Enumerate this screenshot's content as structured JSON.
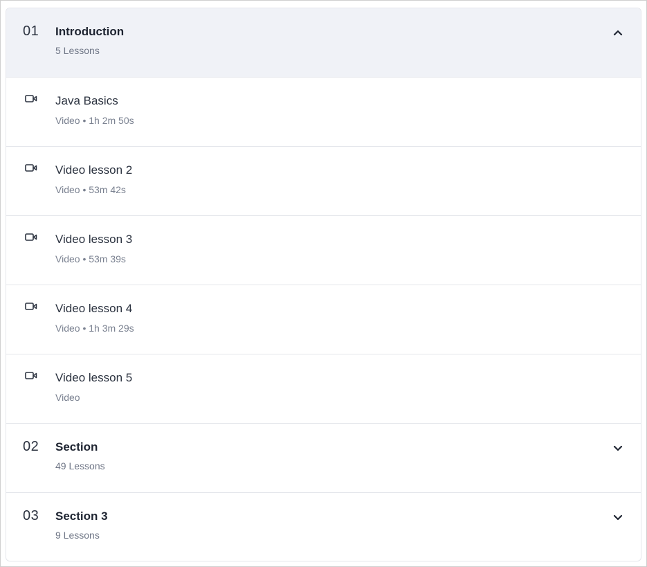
{
  "sections": [
    {
      "number": "01",
      "title": "Introduction",
      "lessons_count": "5 Lessons",
      "expanded": true,
      "chevron": "chevron-up-icon"
    },
    {
      "number": "02",
      "title": "Section",
      "lessons_count": "49 Lessons",
      "expanded": false,
      "chevron": "chevron-down-icon"
    },
    {
      "number": "03",
      "title": "Section 3",
      "lessons_count": "9 Lessons",
      "expanded": false,
      "chevron": "chevron-down-icon"
    }
  ],
  "lessons": [
    {
      "title": "Java Basics",
      "meta": "Video • 1h 2m 50s",
      "icon": "video-camera-icon"
    },
    {
      "title": "Video lesson 2",
      "meta": "Video • 53m 42s",
      "icon": "video-camera-icon"
    },
    {
      "title": "Video lesson 3",
      "meta": "Video • 53m 39s",
      "icon": "video-camera-icon"
    },
    {
      "title": "Video lesson 4",
      "meta": "Video • 1h 3m 29s",
      "icon": "video-camera-icon"
    },
    {
      "title": "Video lesson 5",
      "meta": "Video",
      "icon": "video-camera-icon"
    }
  ],
  "colors": {
    "expanded_section_bg": "#f0f2f7",
    "border": "#e4e6eb",
    "title_text": "#1e2431",
    "muted_text": "#6f7686"
  }
}
